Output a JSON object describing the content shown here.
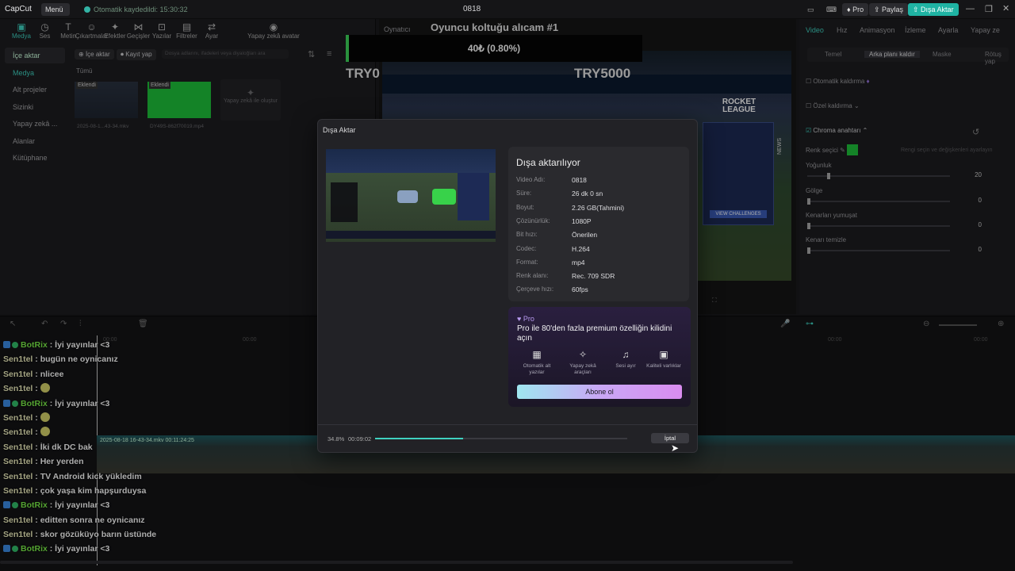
{
  "app": {
    "logo": "CapCut",
    "menu_label": "Menü",
    "saved_status": "Otomatik kaydedildi: 15:30:32",
    "project_title": "0818",
    "pro_label": "Pro",
    "share_label": "Paylaş",
    "export_label": "Dışa Aktar"
  },
  "toolbar": [
    "Medya",
    "Ses",
    "Metin",
    "Çıkartmalar",
    "Efektler",
    "Geçişler",
    "Yazılar",
    "Filtreler",
    "Ayar",
    "Yapay zekâ avatar"
  ],
  "sidenav": [
    "İçe aktar",
    "Medya",
    "Alt projeler",
    "Sizinki",
    "Yapay zekâ ...",
    "Alanlar",
    "Kütüphane"
  ],
  "media": {
    "import_btn": "İçe aktar",
    "record_btn": "Kayıt yap",
    "search_placeholder": "Dosya adlarını, ifadeleri veya diyaloğları ara",
    "all_label": "Tümü",
    "clip1_tag": "Eklendi",
    "clip1_name": "2025-08-1...43-34.mkv",
    "clip2_tag": "Eklendi",
    "clip2_name": "DY49S-862f70019.mp4",
    "ai_card": "Yapay zekâ ile oluştur"
  },
  "player": {
    "label": "Oynatıcı",
    "overlay_title": "Oyuncu koltuğu alıcam #1",
    "overlay_progress": "40₺ (0.80%)",
    "left_amount": "TRY0",
    "right_amount": "TRY5000",
    "game_logo": "ROCKET LEAGUE",
    "news": "NEWS",
    "challenge": "VIEW CHALLENGES"
  },
  "right_tabs": [
    "Video",
    "Hız",
    "Animasyon",
    "İzleme",
    "Ayarla",
    "Yapay ze"
  ],
  "right_subtabs": [
    "Temel",
    "Arka planı kaldır",
    "Maske",
    "Rötuş yap"
  ],
  "right_rows": {
    "auto_remove": "Otomatik kaldırma",
    "custom_remove": "Özel kaldırma",
    "chroma": "Chroma anahtarı",
    "color_picker": "Renk seçici",
    "picker_hint": "Rengi seçin ve değişkenleri ayarlayın",
    "intensity": "Yoğunluk",
    "intensity_val": "20",
    "shadow": "Gölge",
    "shadow_val": "0",
    "edge_soften": "Kenarları yumuşat",
    "edge_soften_val": "0",
    "edge_clean": "Kenarı temizle",
    "edge_clean_val": "0"
  },
  "timeline": {
    "clip_label": "2025-08-18 16-43-34.mkv  00:11:24:25",
    "t0": "00:00",
    "t1": "00:00",
    "t2": "00:00",
    "t3": "00:00"
  },
  "chat": [
    {
      "user": "BotRix",
      "text": " : İyi yayınlar <3",
      "bot": true
    },
    {
      "user": "Sen1tel",
      "text": " : bugün ne oynicanız"
    },
    {
      "user": "Sen1tel",
      "text": " : nlicee"
    },
    {
      "user": "Sen1tel",
      "text": " : ",
      "emoji": true
    },
    {
      "user": "BotRix",
      "text": " : İyi yayınlar <3",
      "bot": true
    },
    {
      "user": "Sen1tel",
      "text": " : ",
      "emoji": true
    },
    {
      "user": "Sen1tel",
      "text": " : ",
      "emoji": true
    },
    {
      "user": "Sen1tel",
      "text": " : İki dk DC bak"
    },
    {
      "user": "Sen1tel",
      "text": " : Her yerden"
    },
    {
      "user": "Sen1tel",
      "text": " : TV Android kick yükledim"
    },
    {
      "user": "Sen1tel",
      "text": " : çok yaşa kim hapşurduysa"
    },
    {
      "user": "BotRix",
      "text": " : İyi yayınlar <3",
      "bot": true
    },
    {
      "user": "Sen1tel",
      "text": " : editten sonra ne oynicanız"
    },
    {
      "user": "Sen1tel",
      "text": " : skor gözüküyo barın üstünde"
    },
    {
      "user": "BotRix",
      "text": " : İyi yayınlar <3",
      "bot": true
    }
  ],
  "dialog": {
    "title": "Dışa Aktar",
    "heading": "Dışa aktarılıyor",
    "rows": [
      {
        "k": "Video Adı:",
        "v": "0818"
      },
      {
        "k": "Süre:",
        "v": "26 dk 0 sn"
      },
      {
        "k": "Boyut:",
        "v": "2.26 GB(Tahmini)"
      },
      {
        "k": "Çözünürlük:",
        "v": "1080P"
      },
      {
        "k": "Bit hızı:",
        "v": "Önerilen"
      },
      {
        "k": "Codec:",
        "v": "H.264"
      },
      {
        "k": "Format:",
        "v": "mp4"
      },
      {
        "k": "Renk alanı:",
        "v": "Rec. 709 SDR"
      },
      {
        "k": "Çerçeve hızı:",
        "v": "60fps"
      }
    ],
    "pro_tag": "Pro",
    "pro_title": "Pro ile 80'den fazla premium özelliğin kilidini açın",
    "features": [
      "Otomatik alt yazılar",
      "Yapay zekâ araçları",
      "Sesi ayır",
      "Kaliteli varlıklar"
    ],
    "subscribe": "Abone ol",
    "percent": "34.8%",
    "elapsed": "00:09:02",
    "progress": 0.348,
    "cancel": "İptal"
  }
}
